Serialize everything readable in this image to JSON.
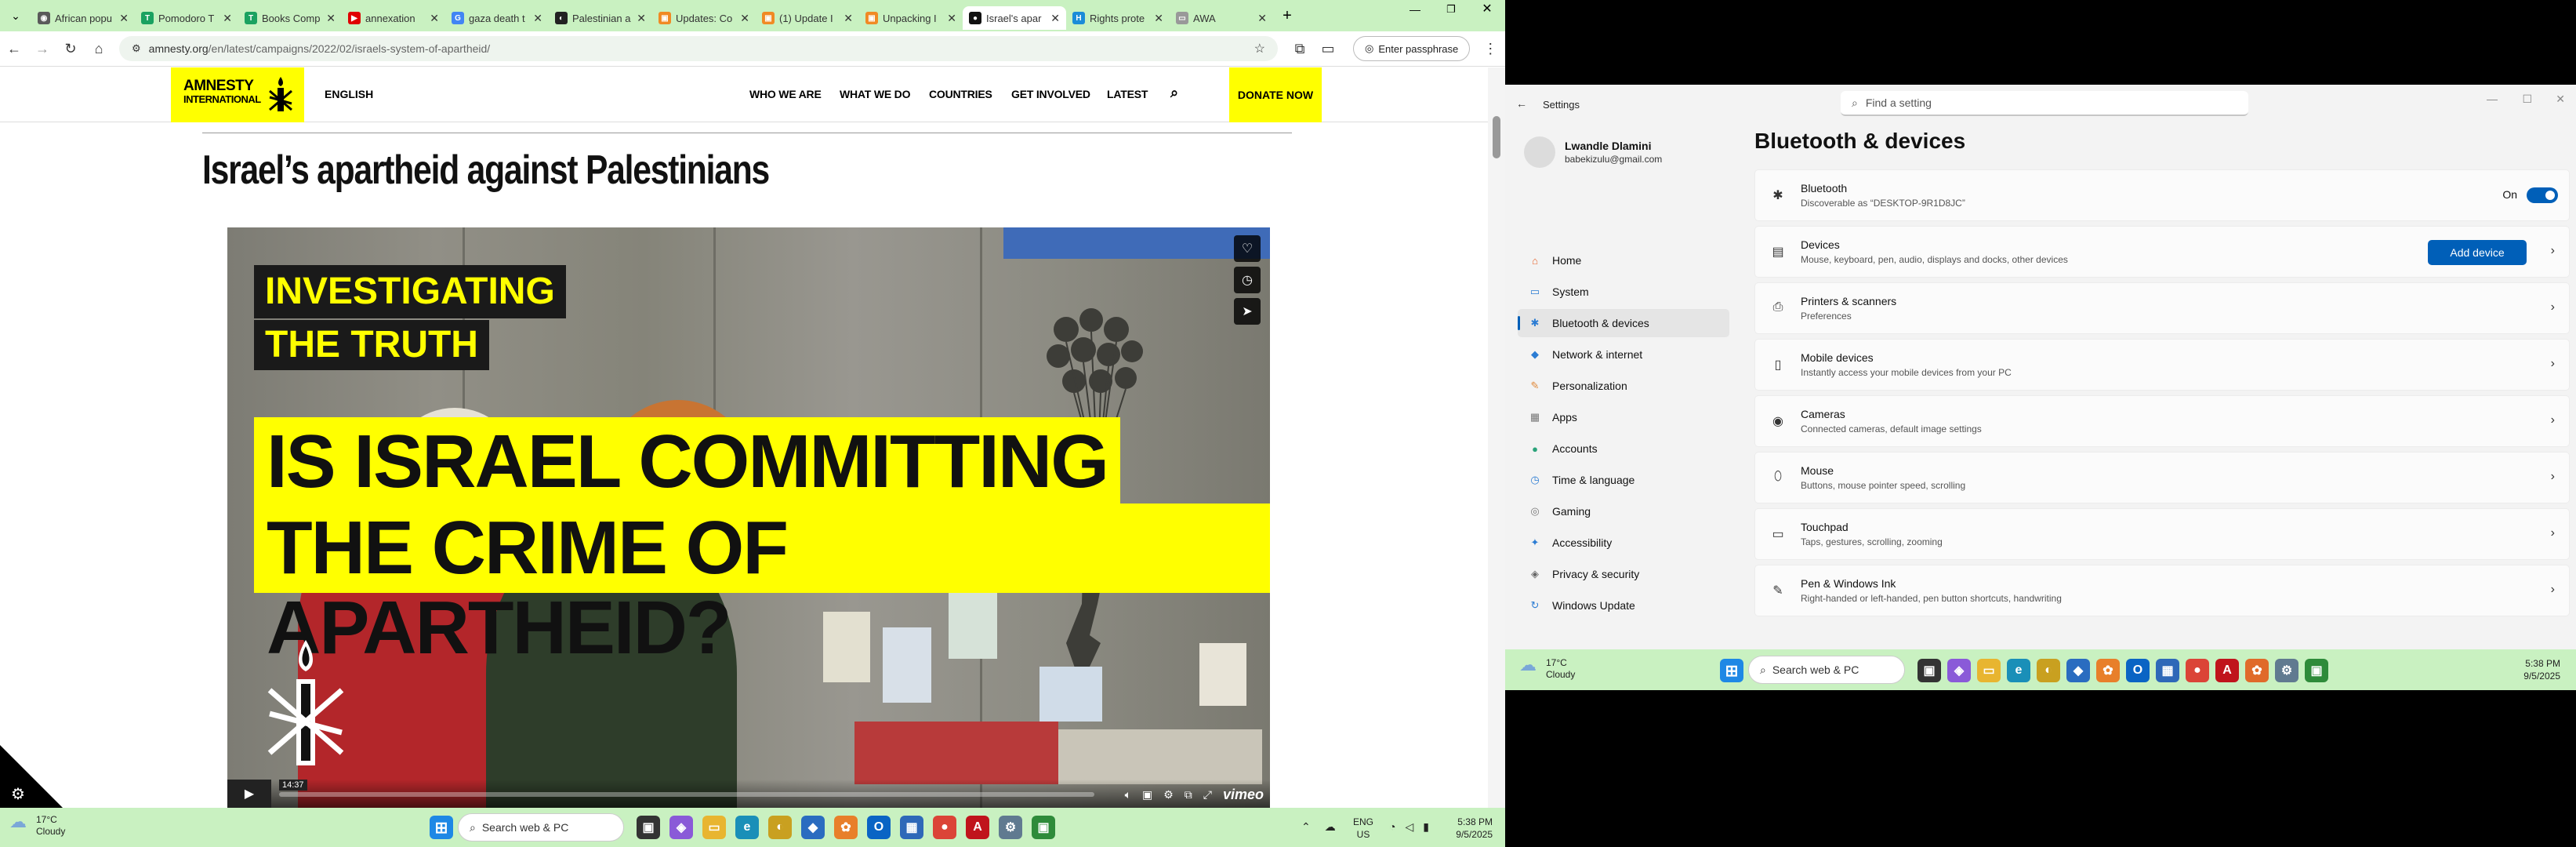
{
  "left": {
    "tabs": [
      {
        "title": "African popu",
        "color": "#5a5a5a",
        "glyph": "◉"
      },
      {
        "title": "Pomodoro T",
        "color": "#1aa260",
        "glyph": "T"
      },
      {
        "title": "Books Comp",
        "color": "#1aa260",
        "glyph": "T"
      },
      {
        "title": "annexation",
        "color": "#e00000",
        "glyph": "▶"
      },
      {
        "title": "gaza death t",
        "color": "#4285f4",
        "glyph": "G"
      },
      {
        "title": "Palestinian a",
        "color": "#222",
        "glyph": "◐"
      },
      {
        "title": "Updates: Co",
        "color": "#f08a24",
        "glyph": "▣"
      },
      {
        "title": "(1) Update I",
        "color": "#f08a24",
        "glyph": "▣"
      },
      {
        "title": "Unpacking I",
        "color": "#f08a24",
        "glyph": "▣"
      },
      {
        "title": "Israel's apar",
        "color": "#111",
        "glyph": "●",
        "active": true
      },
      {
        "title": "Rights prote",
        "color": "#1a8cd8",
        "glyph": "H"
      },
      {
        "title": "AWA",
        "color": "#999",
        "glyph": "▭"
      }
    ],
    "url_host": "amnesty.org",
    "url_path": "/en/latest/campaigns/2022/02/israels-system-of-apartheid/",
    "passphrase": "Enter passphrase",
    "logo_line1": "AMNESTY",
    "logo_line2": "INTERNATIONAL",
    "lang": "ENGLISH",
    "nav": [
      "WHO WE ARE",
      "WHAT WE DO",
      "COUNTRIES",
      "GET INVOLVED",
      "LATEST"
    ],
    "donate": "DONATE NOW",
    "headline": "Israel’s apartheid against Palestinians",
    "video": {
      "tag1": "INVESTIGATING",
      "tag2": "THE TRUTH",
      "big1": "IS ISRAEL COMMITTING",
      "big2": "THE CRIME OF APARTHEID?",
      "time": "14:37",
      "brand": "vimeo"
    },
    "taskbar": {
      "temp": "17°C",
      "cond": "Cloudy",
      "search": "Search web & PC",
      "lang1": "ENG",
      "lang2": "US",
      "time": "5:38 PM",
      "date": "9/5/2025"
    }
  },
  "right": {
    "title": "Settings",
    "search_placeholder": "Find a setting",
    "user_name": "Lwandle Dlamini",
    "user_email": "babekizulu@gmail.com",
    "nav": [
      {
        "label": "Home",
        "color": "#e8642c",
        "glyph": "⌂"
      },
      {
        "label": "System",
        "color": "#2b7cd3",
        "glyph": "▭"
      },
      {
        "label": "Bluetooth & devices",
        "color": "#2b7cd3",
        "glyph": "✱",
        "active": true
      },
      {
        "label": "Network & internet",
        "color": "#2b7cd3",
        "glyph": "◆"
      },
      {
        "label": "Personalization",
        "color": "#e08a3c",
        "glyph": "✎"
      },
      {
        "label": "Apps",
        "color": "#777",
        "glyph": "▦"
      },
      {
        "label": "Accounts",
        "color": "#2aa37a",
        "glyph": "●"
      },
      {
        "label": "Time & language",
        "color": "#2b7cd3",
        "glyph": "◷"
      },
      {
        "label": "Gaming",
        "color": "#777",
        "glyph": "◎"
      },
      {
        "label": "Accessibility",
        "color": "#2b7cd3",
        "glyph": "✦"
      },
      {
        "label": "Privacy & security",
        "color": "#666",
        "glyph": "◈"
      },
      {
        "label": "Windows Update",
        "color": "#2b7cd3",
        "glyph": "↻"
      }
    ],
    "heading": "Bluetooth & devices",
    "cards": [
      {
        "title": "Bluetooth",
        "sub": "Discoverable as “DESKTOP-9R1D8JC”",
        "icon": "✱",
        "toggle": "On"
      },
      {
        "title": "Devices",
        "sub": "Mouse, keyboard, pen, audio, displays and docks, other devices",
        "icon": "▤",
        "button": "Add device"
      },
      {
        "title": "Printers & scanners",
        "sub": "Preferences",
        "icon": "⎙"
      },
      {
        "title": "Mobile devices",
        "sub": "Instantly access your mobile devices from your PC",
        "icon": "▯"
      },
      {
        "title": "Cameras",
        "sub": "Connected cameras, default image settings",
        "icon": "◉"
      },
      {
        "title": "Mouse",
        "sub": "Buttons, mouse pointer speed, scrolling",
        "icon": "⬯"
      },
      {
        "title": "Touchpad",
        "sub": "Taps, gestures, scrolling, zooming",
        "icon": "▭"
      },
      {
        "title": "Pen & Windows Ink",
        "sub": "Right-handed or left-handed, pen button shortcuts, handwriting",
        "icon": "✎"
      }
    ],
    "taskbar": {
      "temp": "17°C",
      "cond": "Cloudy",
      "search": "Search web & PC",
      "time": "5:38 PM",
      "date": "9/5/2025"
    }
  }
}
